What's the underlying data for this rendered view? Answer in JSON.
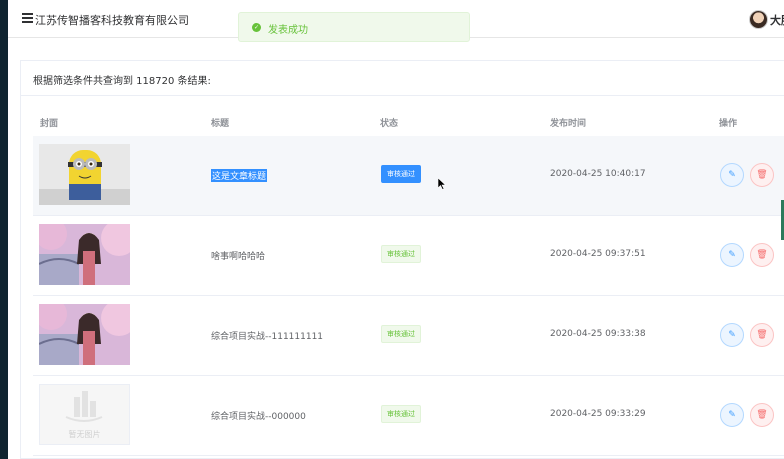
{
  "header": {
    "brand": "江苏传智播客科技教育有限公司",
    "username": "大胖"
  },
  "toast": {
    "message": "发表成功",
    "icon": "success-check-icon"
  },
  "result": {
    "text": "根据筛选条件共查询到 118720 条结果:"
  },
  "table": {
    "headers": [
      "封面",
      "标题",
      "状态",
      "发布时间",
      "操作"
    ],
    "rows": [
      {
        "cover": "minion",
        "title": "这是文章标题",
        "status": "审核通过",
        "time": "2020-04-25 10:40:17",
        "selected": true
      },
      {
        "cover": "anime-girl",
        "title": "啥事啊哈哈哈",
        "status": "审核通过",
        "time": "2020-04-25 09:37:51",
        "selected": false
      },
      {
        "cover": "anime-girl",
        "title": "综合项目实战--111111111",
        "status": "审核通过",
        "time": "2020-04-25 09:33:38",
        "selected": false
      },
      {
        "cover": "placeholder",
        "placeholder_text": "暂无图片",
        "title": "综合项目实战--000000",
        "status": "审核通过",
        "time": "2020-04-25 09:33:29",
        "selected": false
      }
    ]
  },
  "colors": {
    "success": "#67c23a",
    "primary": "#409eff",
    "danger": "#f56c6c",
    "selection": "#3390ff"
  }
}
